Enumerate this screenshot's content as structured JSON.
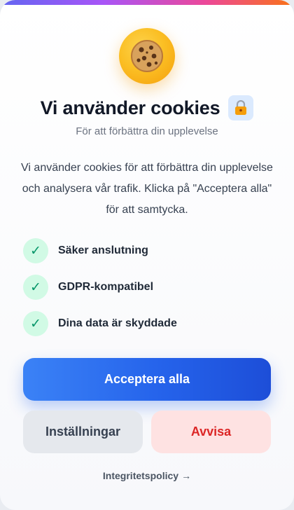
{
  "banner": {
    "cookie_icon": "cookie-icon",
    "title": "Vi använder cookies",
    "lock_icon": "lock-icon",
    "subtitle": "För att förbättra din upplevelse",
    "description": "Vi använder cookies för att förbättra din upplevelse och analysera vår trafik. Klicka på \"Acceptera alla\" för att samtycka."
  },
  "features": [
    {
      "icon": "check-icon",
      "label": "Säker anslutning"
    },
    {
      "icon": "check-icon",
      "label": "GDPR-kompatibel"
    },
    {
      "icon": "check-icon",
      "label": "Dina data är skyddade"
    }
  ],
  "actions": {
    "accept_label": "Acceptera alla",
    "settings_label": "Inställningar",
    "reject_label": "Avvisa"
  },
  "footer": {
    "policy_label": "Integritetspolicy",
    "policy_arrow": "→"
  },
  "colors": {
    "accent": "#2563eb",
    "reject": "#dc2626",
    "check": "#059669",
    "cookie": "#fbbf24"
  }
}
